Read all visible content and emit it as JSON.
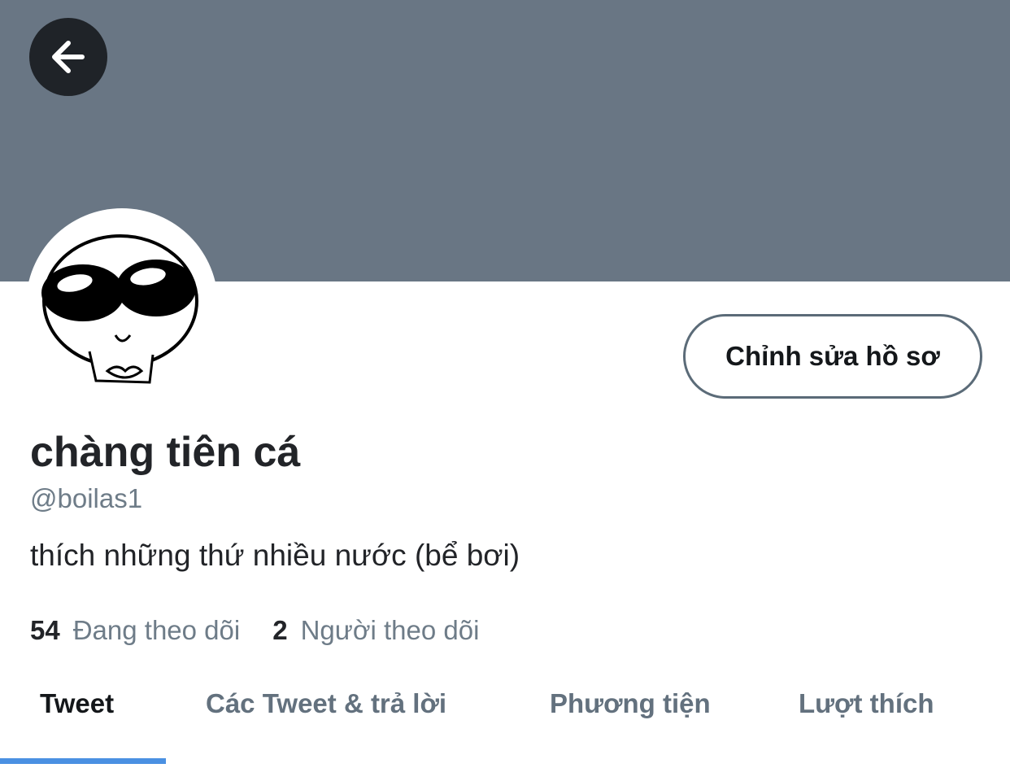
{
  "colors": {
    "banner": "#697684",
    "back_button_bg": "#1f2328",
    "accent": "#4a90e2",
    "text_primary": "#222428",
    "text_secondary": "#6e7c88"
  },
  "header": {
    "back_icon": "arrow-left-icon"
  },
  "profile": {
    "edit_button_label": "Chỉnh sửa hồ sơ",
    "display_name": "chàng tiên cá",
    "handle": "@boilas1",
    "bio": "thích những thứ nhiều nước (bể bơi)",
    "following_count": "54",
    "following_label": "Đang theo dõi",
    "followers_count": "2",
    "followers_label": "Người theo dõi"
  },
  "tabs": [
    {
      "label": "Tweet",
      "active": true
    },
    {
      "label": "Các Tweet & trả lời",
      "active": false
    },
    {
      "label": "Phương tiện",
      "active": false
    },
    {
      "label": "Lượt thích",
      "active": false
    }
  ]
}
